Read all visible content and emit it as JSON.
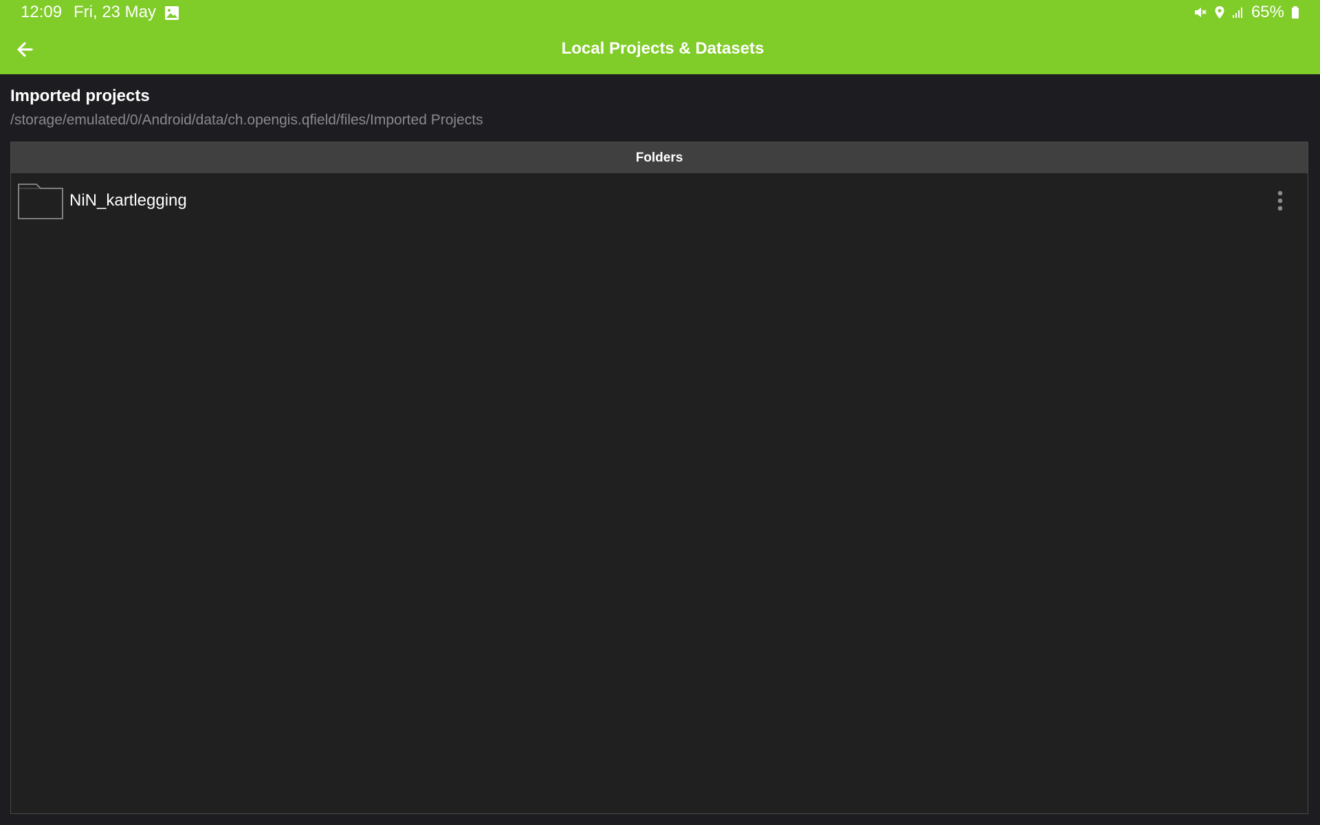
{
  "status_bar": {
    "time": "12:09",
    "date": "Fri, 23 May",
    "battery": "65%",
    "icons": [
      "gallery-icon",
      "mute-icon",
      "location-icon",
      "signal-icon",
      "battery-icon"
    ]
  },
  "app_bar": {
    "title": "Local Projects & Datasets",
    "back_icon": "arrow-left-icon",
    "color": "#80cc28"
  },
  "section": {
    "title": "Imported projects",
    "path": "/storage/emulated/0/Android/data/ch.opengis.qfield/files/Imported Projects"
  },
  "list": {
    "header": "Folders",
    "items": [
      {
        "name": "NiN_kartlegging",
        "icon": "folder-icon",
        "menu_icon": "more-vert-icon"
      }
    ]
  }
}
